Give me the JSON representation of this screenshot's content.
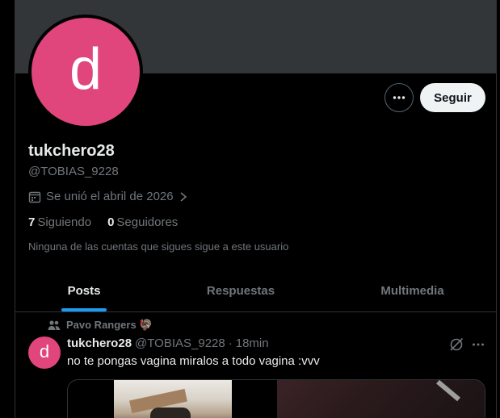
{
  "profile": {
    "avatar_letter": "d",
    "name": "tukchero28",
    "handle": "@TOBIAS_9228",
    "joined": "Se unió el abril de 2026",
    "following_count": "7",
    "following_label": "Siguiendo",
    "followers_count": "0",
    "followers_label": "Seguidores",
    "mutual_note": "Ninguna de las cuentas que sigues sigue a este usuario"
  },
  "actions": {
    "follow_label": "Seguir"
  },
  "tabs": [
    {
      "label": "Posts",
      "active": true
    },
    {
      "label": "Respuestas",
      "active": false
    },
    {
      "label": "Multimedia",
      "active": false
    }
  ],
  "post": {
    "community": "Pavo Rangers 🦃",
    "avatar_letter": "d",
    "author_name": "tukchero28",
    "author_handle": "@TOBIAS_9228",
    "separator": "·",
    "time": "18min",
    "text": "no te pongas vagina miralos a todo vagina :vvv"
  },
  "colors": {
    "accent": "#1d9bf0",
    "avatar": "#e0457b",
    "muted": "#71767b",
    "banner": "#333639"
  },
  "icons": [
    "more-icon",
    "calendar-icon",
    "chevron-right-icon",
    "community-icon",
    "grok-icon",
    "post-more-icon"
  ]
}
